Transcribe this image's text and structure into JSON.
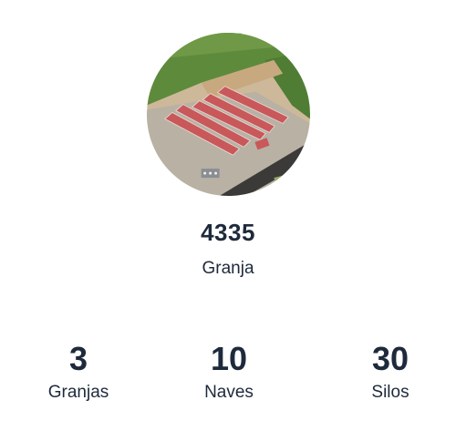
{
  "profile": {
    "photo_icon": "farm-aerial-photo",
    "code": "4335",
    "type": "Granja"
  },
  "stats": [
    {
      "value": "3",
      "label": "Granjas"
    },
    {
      "value": "10",
      "label": "Naves"
    },
    {
      "value": "30",
      "label": "Silos"
    }
  ]
}
